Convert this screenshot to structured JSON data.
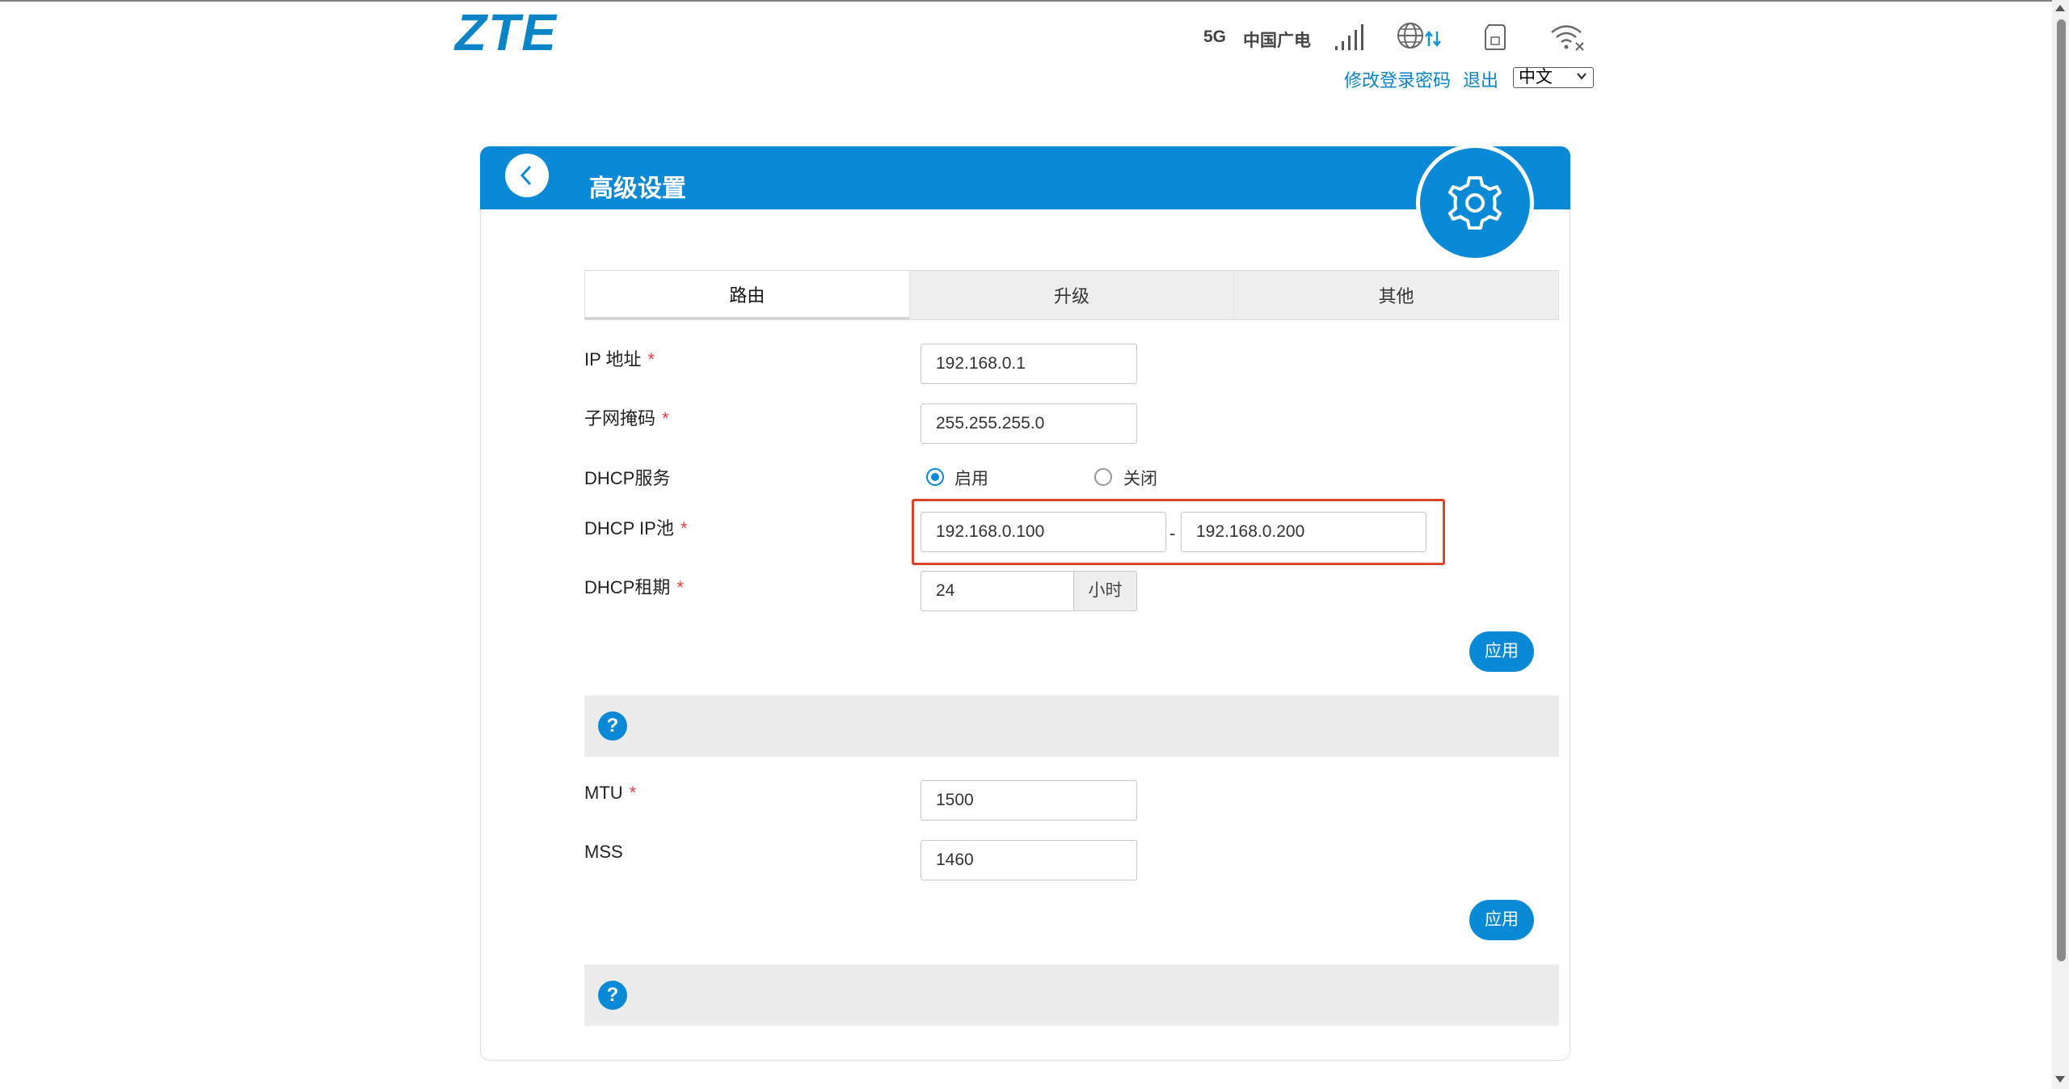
{
  "header": {
    "logo": "ZTE",
    "network_type": "5G",
    "operator": "中国广电",
    "change_password_link": "修改登录密码",
    "logout_link": "退出",
    "language": "中文"
  },
  "page": {
    "title": "高级设置"
  },
  "tabs": [
    {
      "label": "路由",
      "active": true
    },
    {
      "label": "升级",
      "active": false
    },
    {
      "label": "其他",
      "active": false
    }
  ],
  "routing": {
    "ip_address": {
      "label": "IP 地址",
      "required": "*",
      "value": "192.168.0.1"
    },
    "subnet_mask": {
      "label": "子网掩码",
      "required": "*",
      "value": "255.255.255.0"
    },
    "dhcp_service": {
      "label": "DHCP服务",
      "options": [
        {
          "label": "启用",
          "selected": true
        },
        {
          "label": "关闭",
          "selected": false
        }
      ]
    },
    "dhcp_pool": {
      "label": "DHCP IP池",
      "required": "*",
      "start": "192.168.0.100",
      "separator": "-",
      "end": "192.168.0.200"
    },
    "dhcp_lease": {
      "label": "DHCP租期",
      "required": "*",
      "value": "24",
      "unit": "小时"
    },
    "apply_label": "应用"
  },
  "mtu_section": {
    "mtu": {
      "label": "MTU",
      "required": "*",
      "value": "1500"
    },
    "mss": {
      "label": "MSS",
      "value": "1460"
    },
    "apply_label": "应用"
  },
  "help": {
    "icon": "?"
  },
  "colors": {
    "brand": "#0a84c6",
    "header_bar": "#0a8ad6",
    "highlight": "#d9472b",
    "required": "#e24040"
  }
}
